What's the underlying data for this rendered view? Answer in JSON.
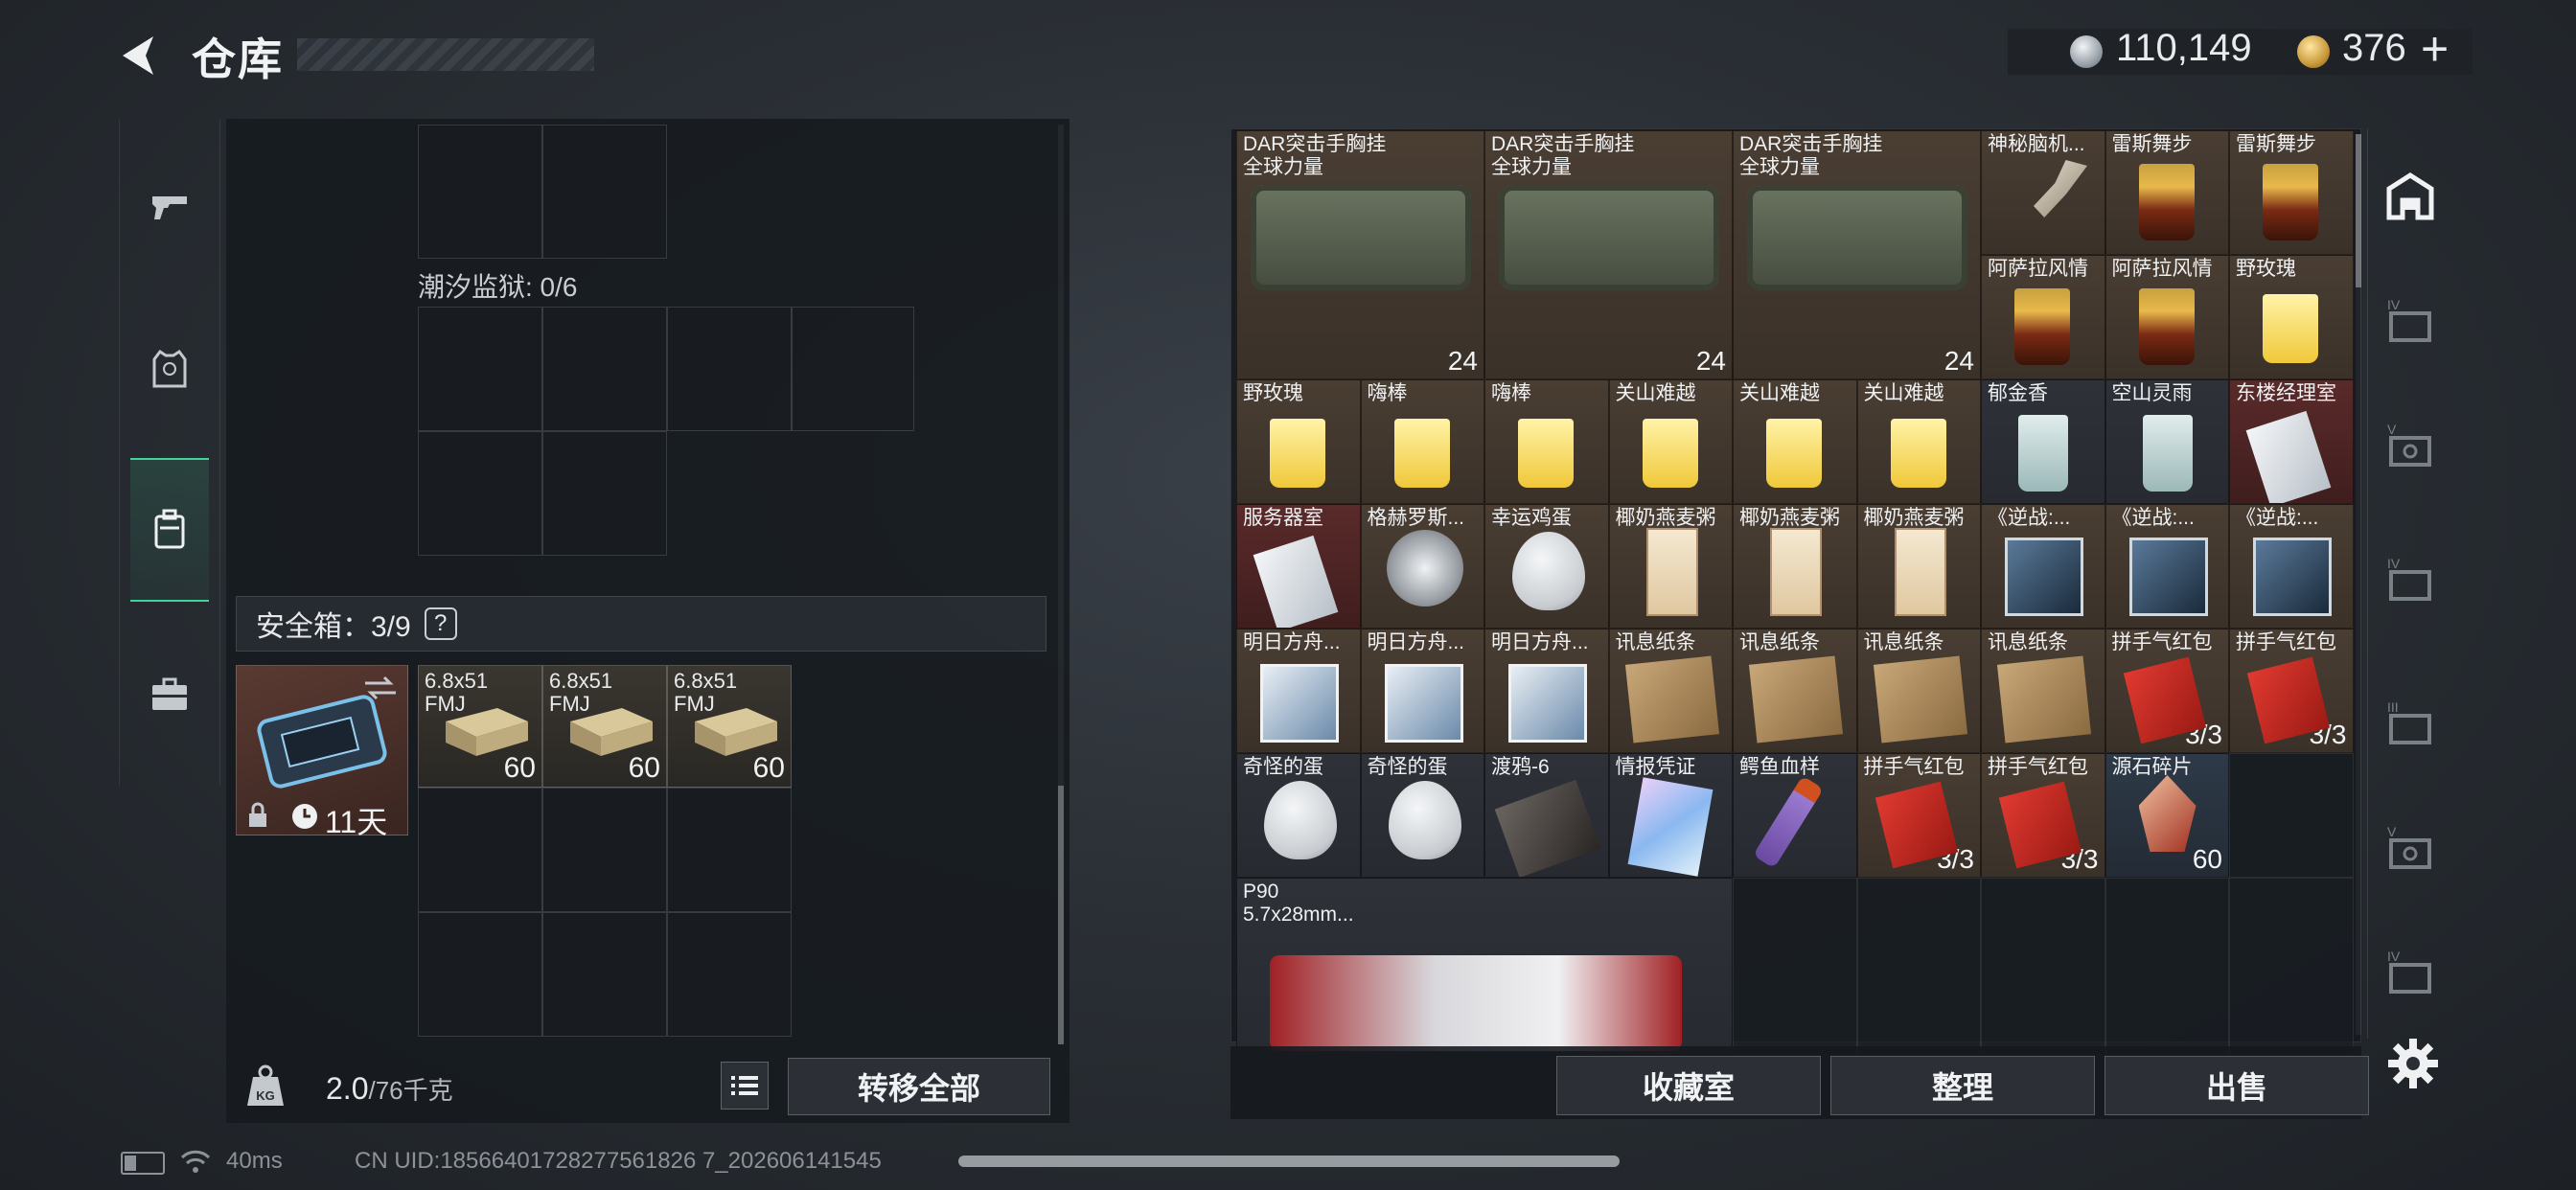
{
  "header": {
    "title": "仓库",
    "silver": "110,149",
    "gold": "376",
    "plus": "+",
    "version": ""
  },
  "left_rail": {
    "items": [
      "pistol-icon",
      "vest-icon",
      "backpack-icon",
      "case-icon"
    ]
  },
  "left_panel": {
    "prison_label": "潮汐监狱: 0/6",
    "safe_label": "安全箱：3/9",
    "safe_help": "?",
    "safebox_days": "11天",
    "ammo": [
      {
        "name": "6.8x51\nFMJ",
        "count": "60"
      },
      {
        "name": "6.8x51\nFMJ",
        "count": "60"
      },
      {
        "name": "6.8x51\nFMJ",
        "count": "60"
      }
    ],
    "weight": "2.0",
    "weight_max": "/76千克",
    "transfer_all": "转移全部"
  },
  "right_panel": {
    "row1_big": [
      {
        "name": "DAR突击手胸挂\n全球力量",
        "count": "24"
      },
      {
        "name": "DAR突击手胸挂\n全球力量",
        "count": "24"
      },
      {
        "name": "DAR突击手胸挂\n全球力量",
        "count": "24"
      }
    ],
    "row1_small": [
      {
        "name": "神秘脑机...",
        "count": ""
      },
      {
        "name": "雷斯舞步",
        "count": ""
      },
      {
        "name": "雷斯舞步",
        "count": ""
      },
      {
        "name": "阿萨拉风情",
        "count": ""
      },
      {
        "name": "阿萨拉风情",
        "count": ""
      },
      {
        "name": "野玫瑰",
        "count": ""
      }
    ],
    "row2": [
      {
        "name": "野玫瑰",
        "count": ""
      },
      {
        "name": "嗨棒",
        "count": ""
      },
      {
        "name": "嗨棒",
        "count": ""
      },
      {
        "name": "关山难越",
        "count": ""
      },
      {
        "name": "关山难越",
        "count": ""
      },
      {
        "name": "关山难越",
        "count": ""
      },
      {
        "name": "郁金香",
        "count": ""
      },
      {
        "name": "空山灵雨",
        "count": ""
      },
      {
        "name": "东楼经理室",
        "count": ""
      }
    ],
    "row3": [
      {
        "name": "服务器室",
        "count": ""
      },
      {
        "name": "格赫罗斯...",
        "count": ""
      },
      {
        "name": "幸运鸡蛋",
        "count": ""
      },
      {
        "name": "椰奶燕麦粥",
        "count": ""
      },
      {
        "name": "椰奶燕麦粥",
        "count": ""
      },
      {
        "name": "椰奶燕麦粥",
        "count": ""
      },
      {
        "name": "《逆战:...",
        "count": ""
      },
      {
        "name": "《逆战:...",
        "count": ""
      },
      {
        "name": "《逆战:...",
        "count": ""
      }
    ],
    "row4": [
      {
        "name": "明日方舟...",
        "count": ""
      },
      {
        "name": "明日方舟...",
        "count": ""
      },
      {
        "name": "明日方舟...",
        "count": ""
      },
      {
        "name": "讯息纸条",
        "count": ""
      },
      {
        "name": "讯息纸条",
        "count": ""
      },
      {
        "name": "讯息纸条",
        "count": ""
      },
      {
        "name": "讯息纸条",
        "count": ""
      },
      {
        "name": "拼手气红包",
        "count": "3/3"
      },
      {
        "name": "拼手气红包",
        "count": "3/3"
      }
    ],
    "row5": [
      {
        "name": "奇怪的蛋",
        "count": ""
      },
      {
        "name": "奇怪的蛋",
        "count": ""
      },
      {
        "name": "渡鸦-6",
        "count": ""
      },
      {
        "name": "情报凭证",
        "count": ""
      },
      {
        "name": "鳄鱼血样",
        "count": ""
      },
      {
        "name": "拼手气红包",
        "count": "3/3"
      },
      {
        "name": "拼手气红包",
        "count": "3/3"
      },
      {
        "name": "源石碎片",
        "count": "60"
      }
    ],
    "weapon": {
      "name": "P90\n5.7x28mm...",
      "count": ""
    },
    "buttons": {
      "collection": "收藏室",
      "sort": "整理",
      "sell": "出售"
    }
  },
  "right_rail": {
    "items": [
      "home-icon",
      "tier-iv-case-icon",
      "tier-v-safe-icon",
      "tier-iv-folder-icon",
      "tier-iii-case-icon",
      "tier-v-case-icon",
      "tier-iv-pack-icon"
    ]
  },
  "status": {
    "ping": "40ms",
    "uid": "CN UID:18566401728277561826 7_202606141545"
  },
  "colors": {
    "accent": "#3fd49a",
    "tile_brown": "#4a3e33",
    "tile_red": "#5a2a2a"
  }
}
